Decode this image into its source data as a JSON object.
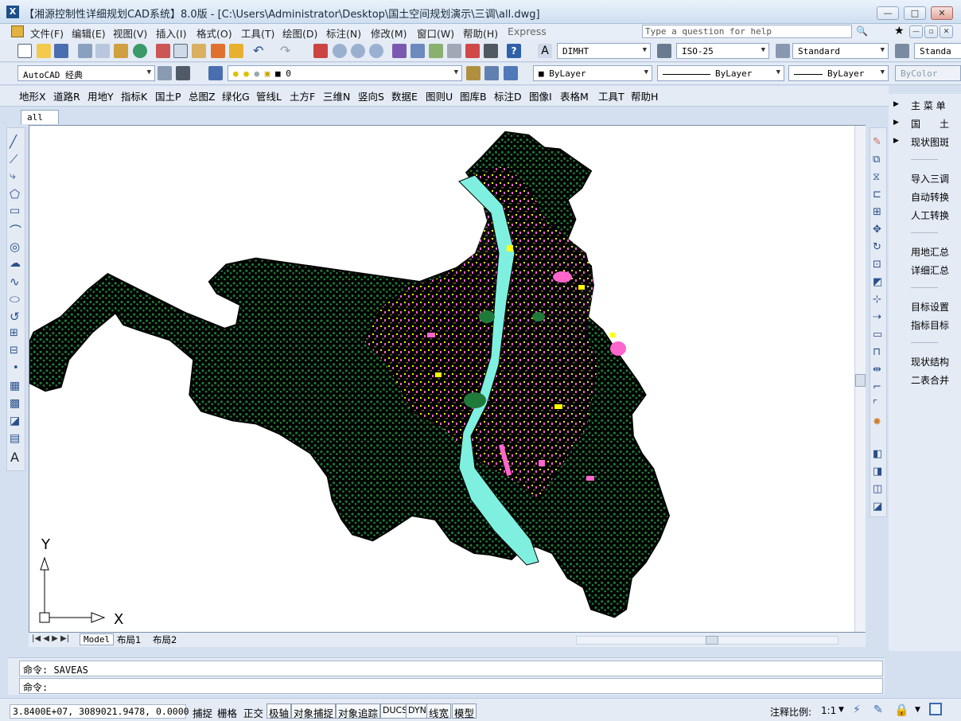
{
  "window": {
    "title": "【湘源控制性详细规划CAD系统】8.0版 - [C:\\Users\\Administrator\\Desktop\\国土空间规划演示\\三调\\all.dwg]",
    "app_icon_glyph": "X",
    "minimize": "—",
    "restore": "□",
    "close": "✕"
  },
  "menu": {
    "items": [
      "文件(F)",
      "编辑(E)",
      "视图(V)",
      "插入(I)",
      "格式(O)",
      "工具(T)",
      "绘图(D)",
      "标注(N)",
      "修改(M)",
      "窗口(W)",
      "帮助(H)",
      "Express"
    ],
    "help_placeholder": "Type a question for help"
  },
  "toolbar1": {
    "text_style": "DIMHT",
    "dim_style": "ISO-25",
    "table_style": "Standard",
    "multileader_style": "Standa"
  },
  "toolbar2": {
    "workspace": "AutoCAD 经典",
    "layer": "0",
    "color": "ByLayer",
    "linetype": "ByLayer",
    "lineweight": "ByLayer",
    "plotstyle": "ByColor"
  },
  "cn_toolbar": {
    "items": [
      "地形X",
      "道路R",
      "用地Y",
      "指标K",
      "国土P",
      "总图Z",
      "绿化G",
      "管线L",
      "土方F",
      "三维N",
      "竖向S",
      "数据E",
      "图则U",
      "图库B",
      "标注D",
      "图像I",
      "表格M",
      "工具T",
      "帮助H"
    ]
  },
  "doc_tab": "all",
  "layout_tabs": [
    "Model",
    "布局1",
    "布局2"
  ],
  "ucs": {
    "x_label": "X",
    "y_label": "Y"
  },
  "right_palette": {
    "main_menu": "主 菜 单",
    "guotu": "国　　土",
    "xianzhuang": "现状图斑",
    "import": "导入三调",
    "auto": "自动转换",
    "manual": "人工转换",
    "landsum": "用地汇总",
    "detailsum": "详细汇总",
    "target_set": "目标设置",
    "index_target": "指标目标",
    "structure": "现状结构",
    "merge": "二表合并"
  },
  "command": {
    "line1": "命令: SAVEAS",
    "line2": "命令:"
  },
  "status": {
    "coords": "3.8400E+07, 3089021.9478, 0.0000",
    "buttons": [
      "捕捉",
      "栅格",
      "正交",
      "极轴",
      "对象捕捉",
      "对象追踪",
      "DUCS",
      "DYN",
      "线宽",
      "模型"
    ],
    "on_buttons": [
      "极轴",
      "对象捕捉",
      "对象追踪",
      "DUCS",
      "DYN",
      "线宽",
      "模型"
    ],
    "anno_label": "注释比例:",
    "anno_value": "1:1"
  },
  "colors": {
    "land": "#000000",
    "forest": "#1f7a3a",
    "river": "#7ff0e0",
    "urban_pink": "#ff66cc",
    "urban_yellow": "#ffff00"
  }
}
